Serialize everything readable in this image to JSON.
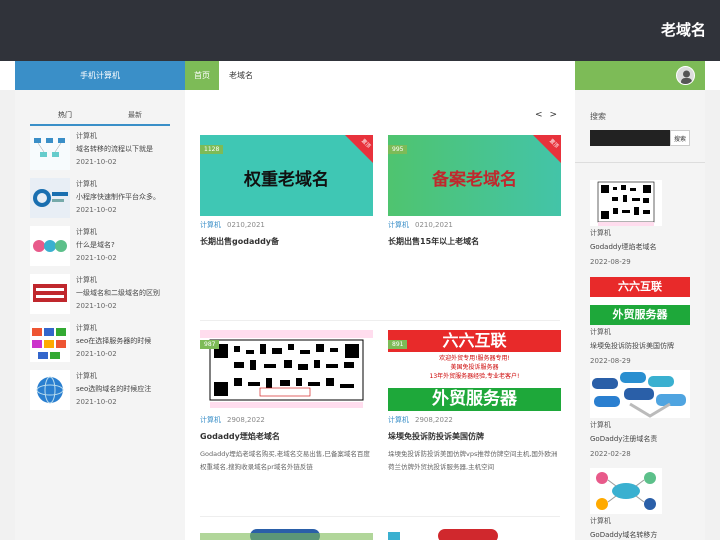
{
  "header": {
    "site_title": "老域名"
  },
  "nav": {
    "left_label": "手机计算机",
    "home_label": "首页",
    "crumb": "老域名"
  },
  "sidebar": {
    "tabs": [
      {
        "label": "热门"
      },
      {
        "label": "最新"
      }
    ],
    "items": [
      {
        "category": "计算机",
        "title": "域名转移的流程以下就是",
        "date": "2021-10-02",
        "thumb": "flow-diagram"
      },
      {
        "category": "计算机",
        "title": "小程序快速制作平台众多。",
        "date": "2021-10-02",
        "thumb": "gc-logo"
      },
      {
        "category": "计算机",
        "title": "什么是域名?",
        "date": "2021-10-02",
        "thumb": "domain-bubbles"
      },
      {
        "category": "计算机",
        "title": "一级域名和二级域名的区别",
        "date": "2021-10-02",
        "thumb": "laoyuming-text"
      },
      {
        "category": "计算机",
        "title": "seo在选择服务器的时候",
        "date": "2021-10-02",
        "thumb": "tld-letters"
      },
      {
        "category": "计算机",
        "title": "seo选购域名的时候应注",
        "date": "2021-10-02",
        "thumb": "globe"
      }
    ]
  },
  "main": {
    "pager": "< >",
    "cards": [
      {
        "image_text": "权重老域名",
        "badge": "1128",
        "corner": "置顶",
        "category": "计算机",
        "date": "0210,2021",
        "title": "长期出售godaddy备",
        "description": ""
      },
      {
        "image_text": "备案老域名",
        "badge": "995",
        "corner": "置顶",
        "category": "计算机",
        "date": "0210,2021",
        "title": "长期出售15年以上老域名",
        "description": ""
      },
      {
        "image_text": "",
        "badge": "987",
        "corner": "",
        "category": "计算机",
        "date": "2908,2022",
        "title": "Godaddy堙焰老域名",
        "description": "Godaddy堙焰老域名购买,老域名交易出售,巳备案域名百度权重域名,搜狗收录域名pr域名外链反链"
      },
      {
        "image_text": "",
        "badge": "891",
        "corner": "",
        "category": "计算机",
        "date": "2908,2022",
        "title": "垛堧免投诉防投诉美国仿牌",
        "description": "垛堧免投诉防投诉美国仿牌vps推荐仿牌空间主机,国外欧洲荷兰仿牌外贸抗投诉服务器,主机空间"
      }
    ],
    "ad3_lines": [
      "六六互联",
      "外贸服务器",
      "欢迎外贸专用!服务器专用!",
      "美国免投诉服务器",
      "13年外贸服务器经验,专业老客户!"
    ]
  },
  "right": {
    "search_label": "搜索",
    "search_button": "搜索",
    "search_placeholder": "",
    "items": [
      {
        "category": "计算机",
        "title": "Godaddy堙焰老域名",
        "date": "2022-08-29",
        "thumb": "qr"
      },
      {
        "category": "计算机",
        "title": "垛堧免投诉防投诉美国仿牌",
        "date": "2022-08-29",
        "thumb": "liuliu"
      },
      {
        "category": "计算机",
        "title": "GoDaddy注册域名责",
        "date": "2022-02-28",
        "thumb": "tld-bubbles"
      },
      {
        "category": "计算机",
        "title": "GoDaddy域名转移方",
        "date": "",
        "thumb": "network"
      }
    ],
    "thumb_texts": {
      "liuliu_top": "六六互联",
      "liuliu_bottom": "外贸服务器"
    }
  },
  "colors": {
    "topbar": "#30333a",
    "blue": "#3a8fc8",
    "green": "#7dbb57",
    "red": "#e8323c",
    "teal_card": "#3fc7b4"
  }
}
